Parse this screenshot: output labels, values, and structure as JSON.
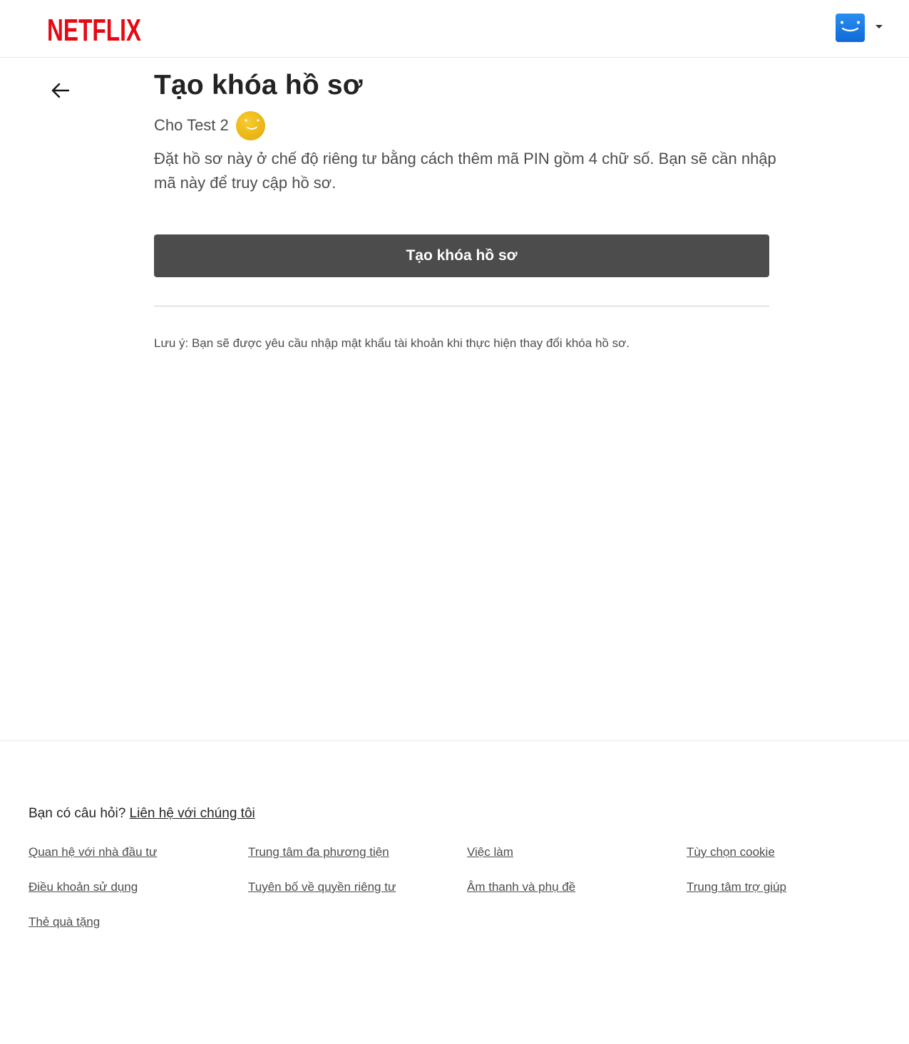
{
  "header": {
    "logo_text": "NETFLIX",
    "brand_color": "#e50914",
    "avatar_icon": "smiley-face-icon",
    "menu_icon": "caret-down-icon"
  },
  "nav": {
    "back_icon": "arrow-left-icon"
  },
  "main": {
    "title": "Tạo khóa hồ sơ",
    "profile_name": "Cho Test 2",
    "description": "Đặt hồ sơ này ở chế độ riêng tư bằng cách thêm mã PIN gồm 4 chữ số. Bạn sẽ cần nhập mã này để truy cập hồ sơ.",
    "create_button_label": "Tạo khóa hồ sơ",
    "note": "Lưu ý: Bạn sẽ được yêu cầu nhập mật khẩu tài khoản khi thực hiện thay đổi khóa hồ sơ."
  },
  "footer": {
    "question": "Bạn có câu hỏi?",
    "contact_link": "Liên hệ với chúng tôi",
    "links": [
      "Quan hệ với nhà đầu tư",
      "Trung tâm đa phương tiện",
      "Việc làm",
      "Tùy chọn cookie",
      "Điều khoản sử dụng",
      "Tuyên bố về quyền riêng tư",
      "Âm thanh và phụ đề",
      "Trung tâm trợ giúp",
      "Thẻ quà tặng"
    ]
  }
}
